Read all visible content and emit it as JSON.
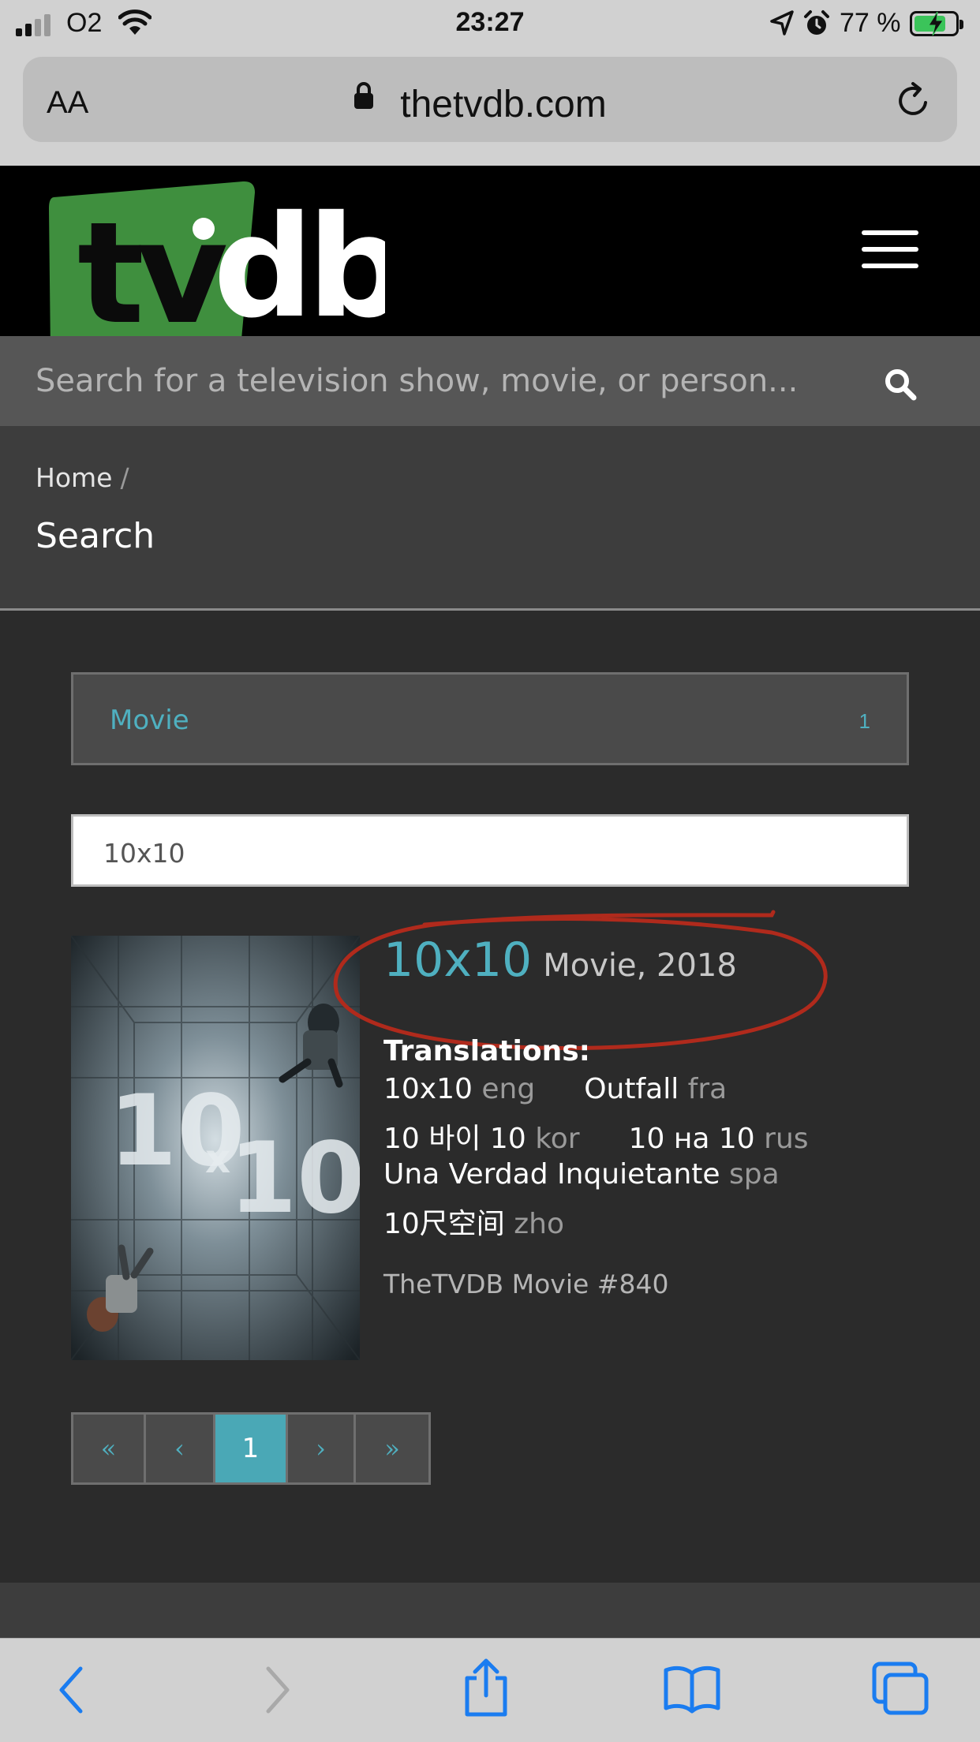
{
  "status_bar": {
    "carrier": "O2",
    "time": "23:27",
    "battery": "77 %",
    "battery_level": 0.77
  },
  "browser": {
    "text_size_label": "AA",
    "host": "thetvdb.com"
  },
  "site": {
    "logo_text": "tvdb",
    "search_placeholder": "Search for a television show, movie, or person..."
  },
  "breadcrumb": {
    "home": "Home",
    "separator": "/",
    "page_title": "Search"
  },
  "facet": {
    "label": "Movie",
    "count": "1"
  },
  "query": {
    "value": "10x10"
  },
  "result": {
    "title": "10x10",
    "meta": "Movie, 2018",
    "translations_heading": "Translations:",
    "translations": [
      {
        "name": "10x10",
        "lang": "eng"
      },
      {
        "name": "Outfall",
        "lang": "fra"
      },
      {
        "name": "10 바이 10",
        "lang": "kor"
      },
      {
        "name": "10 на 10",
        "lang": "rus"
      },
      {
        "name": "Una Verdad Inquietante",
        "lang": "spa"
      },
      {
        "name": "10尺空间",
        "lang": "zho"
      }
    ],
    "id_label": "TheTVDB Movie #840",
    "poster_text": {
      "left": "10",
      "mid": "x",
      "right": "10"
    }
  },
  "pagination": {
    "first": "«",
    "prev": "‹",
    "current": "1",
    "next": "›",
    "last": "»"
  },
  "colors": {
    "accent": "#4fb0c0",
    "logo_green": "#3f8f3e",
    "annotation_red": "#b02a1c"
  }
}
